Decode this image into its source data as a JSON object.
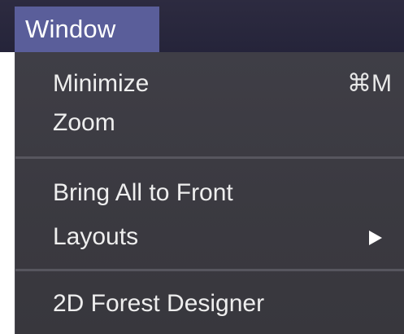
{
  "menubar": {
    "title": "Window"
  },
  "menu": {
    "minimize": {
      "label": "Minimize",
      "shortcut": "⌘M"
    },
    "zoom": {
      "label": "Zoom"
    },
    "bring_all_to_front": {
      "label": "Bring All to Front"
    },
    "layouts": {
      "label": "Layouts",
      "has_submenu": true,
      "arrow_icon": "submenu-arrow-icon"
    },
    "forest_designer": {
      "label": "2D Forest Designer"
    }
  },
  "colors": {
    "menubar_bg": "#2d2b40",
    "menu_title_highlight": "#5a5e9a",
    "menu_panel_bg": "#3d3c43",
    "separator": "#57565e",
    "text": "#eeeeee"
  }
}
